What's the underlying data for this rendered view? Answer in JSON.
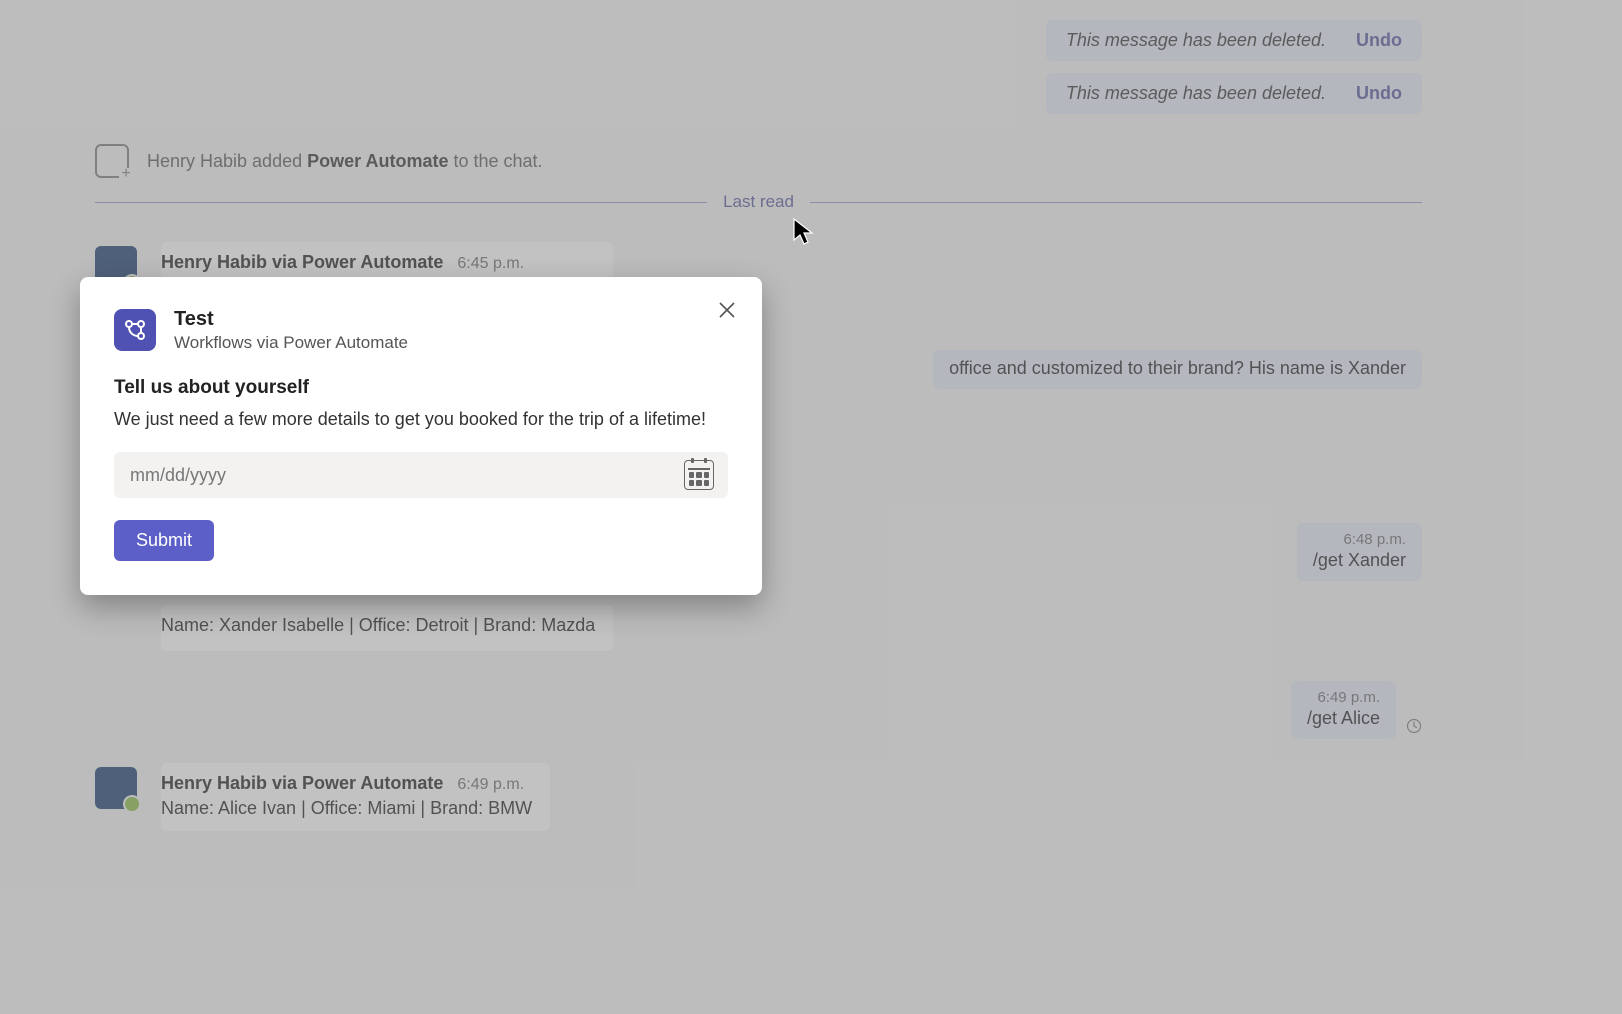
{
  "deleted_messages": [
    {
      "text": "This message has been deleted.",
      "undo": "Undo"
    },
    {
      "text": "This message has been deleted.",
      "undo": "Undo"
    }
  ],
  "system_event": {
    "prefix": "Henry Habib added ",
    "bold": "Power Automate",
    "suffix": " to the chat."
  },
  "last_read_label": "Last read",
  "messages": [
    {
      "kind": "bot",
      "name": "Henry Habib via Power Automate",
      "time": "6:45 p.m.",
      "body": "Name: Xander Isabelle | Office: Detroit | Brand: Mazda"
    },
    {
      "kind": "user_long",
      "body_suffix": "office and customized to their brand? His name is Xander"
    },
    {
      "kind": "user_short",
      "time": "6:48 p.m.",
      "body": "/get Xander"
    },
    {
      "kind": "bot_partial",
      "body": "Name: Xander Isabelle | Office: Detroit | Brand: Mazda"
    },
    {
      "kind": "user_short_pending",
      "time": "6:49 p.m.",
      "body": "/get Alice"
    },
    {
      "kind": "bot",
      "name": "Henry Habib via Power Automate",
      "time": "6:49 p.m.",
      "body": "Name: Alice Ivan | Office: Miami | Brand: BMW"
    }
  ],
  "modal": {
    "title": "Test",
    "subtitle": "Workflows via Power Automate",
    "heading": "Tell us about yourself",
    "description": "We just need a few more details to get you booked for the trip of a lifetime!",
    "date_placeholder": "mm/dd/yyyy",
    "submit_label": "Submit"
  }
}
